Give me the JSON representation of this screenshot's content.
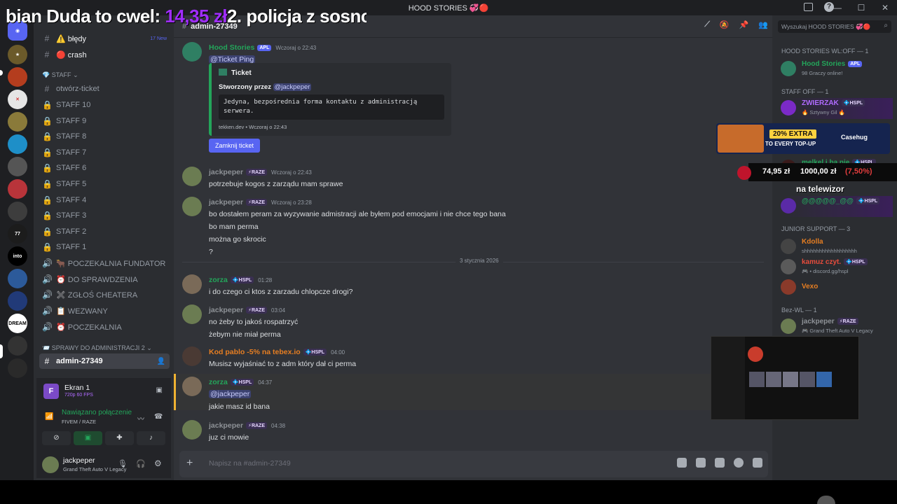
{
  "window": {
    "title": "HOOD STORIES 💞🔴",
    "controls": [
      "—",
      "☐",
      "✕"
    ]
  },
  "ticker": {
    "prefix": "bian Duda to cwel: ",
    "amount": "14,35 zł",
    "suffix": "2. policja z sosnc"
  },
  "sidebar": {
    "channels_top": [
      {
        "label": "⚠️ błędy",
        "badge": "17 New"
      },
      {
        "label": "🔴 crash"
      }
    ],
    "category_staff": "STAFF",
    "channels": [
      {
        "icon": "#",
        "label": "otwórz-ticket"
      },
      {
        "icon": "🔒",
        "label": "STAFF 10"
      },
      {
        "icon": "🔒",
        "label": "STAFF 9"
      },
      {
        "icon": "🔒",
        "label": "STAFF 8"
      },
      {
        "icon": "🔒",
        "label": "STAFF 7"
      },
      {
        "icon": "🔒",
        "label": "STAFF 6"
      },
      {
        "icon": "🔒",
        "label": "STAFF 5"
      },
      {
        "icon": "🔒",
        "label": "STAFF 4"
      },
      {
        "icon": "🔒",
        "label": "STAFF 3"
      },
      {
        "icon": "🔒",
        "label": "STAFF 2"
      },
      {
        "icon": "🔒",
        "label": "STAFF 1"
      },
      {
        "icon": "🔊",
        "label": "🐂 POCZEKALNIA FUNDATOR"
      },
      {
        "icon": "🔊",
        "label": "⏰ DO SPRAWDZENIA"
      },
      {
        "icon": "🔊",
        "label": "✖️ ZGŁOŚ CHEATERA"
      },
      {
        "icon": "🔊",
        "label": "📋 WEZWANY"
      },
      {
        "icon": "🔊",
        "label": "⏰ POCZEKALNIA"
      }
    ],
    "category_admin": "SPRAWY DO ADMINISTRACJI 2",
    "active_channel": "admin-27349"
  },
  "voice": {
    "stream_title": "Ekran 1",
    "stream_quality": "720p 60 FPS",
    "status": "Nawiązano połączenie",
    "server": "FIVEM / RAZE"
  },
  "user": {
    "name": "jackpeper",
    "activity": "Grand Theft Auto V Legacy"
  },
  "chat": {
    "channel": "admin-27349",
    "date_divider": "3 stycznia 2026",
    "composer_placeholder": "Napisz na #admin-27349",
    "embed": {
      "author": "Hood Stories",
      "author_tag": "APL",
      "timestamp": "Wczoraj o 22:43",
      "ping": "@Ticket Ping",
      "title": "Ticket",
      "created_label": "Stworzony przez",
      "created_by": "@jackpeper",
      "code": "Jedyna, bezpośrednia forma kontaktu z administracją serwera.",
      "footer": "tekken.dev • Wczoraj o 22:43",
      "button": "Zamknij ticket"
    },
    "messages": [
      {
        "user": "jackpeper",
        "color": "#8e9297",
        "tag": "⚡RAZE",
        "time": "Wczoraj o 22:43",
        "lines": [
          "potrzebuje kogos z zarządu mam sprawe"
        ]
      },
      {
        "user": "jackpeper",
        "color": "#8e9297",
        "tag": "⚡RAZE",
        "time": "Wczoraj o 23:28",
        "lines": [
          "bo dostałem peram za wyzywanie admistracji ale byłem pod emocjami i nie chce tego bana",
          "bo mam perma",
          "można go skrocic",
          "?"
        ]
      },
      {
        "user": "zorza",
        "color": "#23a55a",
        "tag": "💠HSPL",
        "time": "01:28",
        "lines": [
          "i do czego ci ktos z zarzadu chlopcze drogi?"
        ]
      },
      {
        "user": "jackpeper",
        "color": "#8e9297",
        "tag": "⚡RAZE",
        "time": "03:04",
        "lines": [
          "no żeby to jakoś rospatrzyć",
          "żebym nie miał perma"
        ]
      },
      {
        "user": "Kod pablo -5% na tebex.io",
        "color": "#e67e22",
        "tag": "💠HSPL",
        "time": "04:00",
        "lines": [
          "Musisz wyjaśniać to z adm który dał ci perma"
        ]
      },
      {
        "user": "zorza",
        "color": "#23a55a",
        "tag": "💠HSPL",
        "time": "04:37",
        "mention": "@jackpeper",
        "lines": [
          "jakie masz id bana"
        ]
      },
      {
        "user": "jackpeper",
        "color": "#8e9297",
        "tag": "⚡RAZE",
        "time": "04:38",
        "lines": [
          "juz ci mowie"
        ]
      }
    ]
  },
  "search": {
    "placeholder": "Wyszukaj HOOD STORIES 💞🔴"
  },
  "members": {
    "groups": [
      {
        "title": "HOOD STORIES WL:OFF — 1"
      },
      {
        "title": "STAFF OFF — 1"
      },
      {
        "title": "JUNIOR SUPPORT — 3"
      },
      {
        "title": "Bez-WL — 1"
      }
    ],
    "list": [
      {
        "name": "Hood Stories",
        "tag": "APL",
        "status": "98 Graczy online!",
        "color": "#23a55a"
      },
      {
        "name": "ZWIERZAK",
        "tag": "💠HSPL",
        "status": "🔥 Sztywny Gil 🔥",
        "color": "#b06bff"
      },
      {
        "name": "melkel i ba nie",
        "tag": "💠HSPL",
        "status": "",
        "color": "#23a55a"
      },
      {
        "name": "na telewizor",
        "tag": "💠HSPL",
        "status": "",
        "color": "#ffffff"
      },
      {
        "name": "@@@@@_@@",
        "tag": "💠HSPL",
        "status": "",
        "color": "#23a55a"
      },
      {
        "name": "Kdolla",
        "tag": "",
        "status": "shhhhhhhhhhhhhhhhhh",
        "color": "#e67e22"
      },
      {
        "name": "kamuz czyt.",
        "tag": "💠HSPL",
        "status": "🎮 • discord.gg/hspl",
        "color": "#e74c3c"
      },
      {
        "name": "Vexo",
        "tag": "",
        "status": "",
        "color": "#e67e22"
      },
      {
        "name": "jackpeper",
        "tag": "⚡RAZE",
        "status": "🎮 Grand Theft Auto V Legacy",
        "color": "#8e9297"
      }
    ]
  },
  "overlay": {
    "promo_badge": "20% EXTRA",
    "promo_text": "TO EVERY TOP-UP",
    "promo_brand": "Casehug",
    "odds_a": "74,95 zł",
    "odds_b": "1000,00 zł",
    "odds_c": "(7,50%)"
  }
}
